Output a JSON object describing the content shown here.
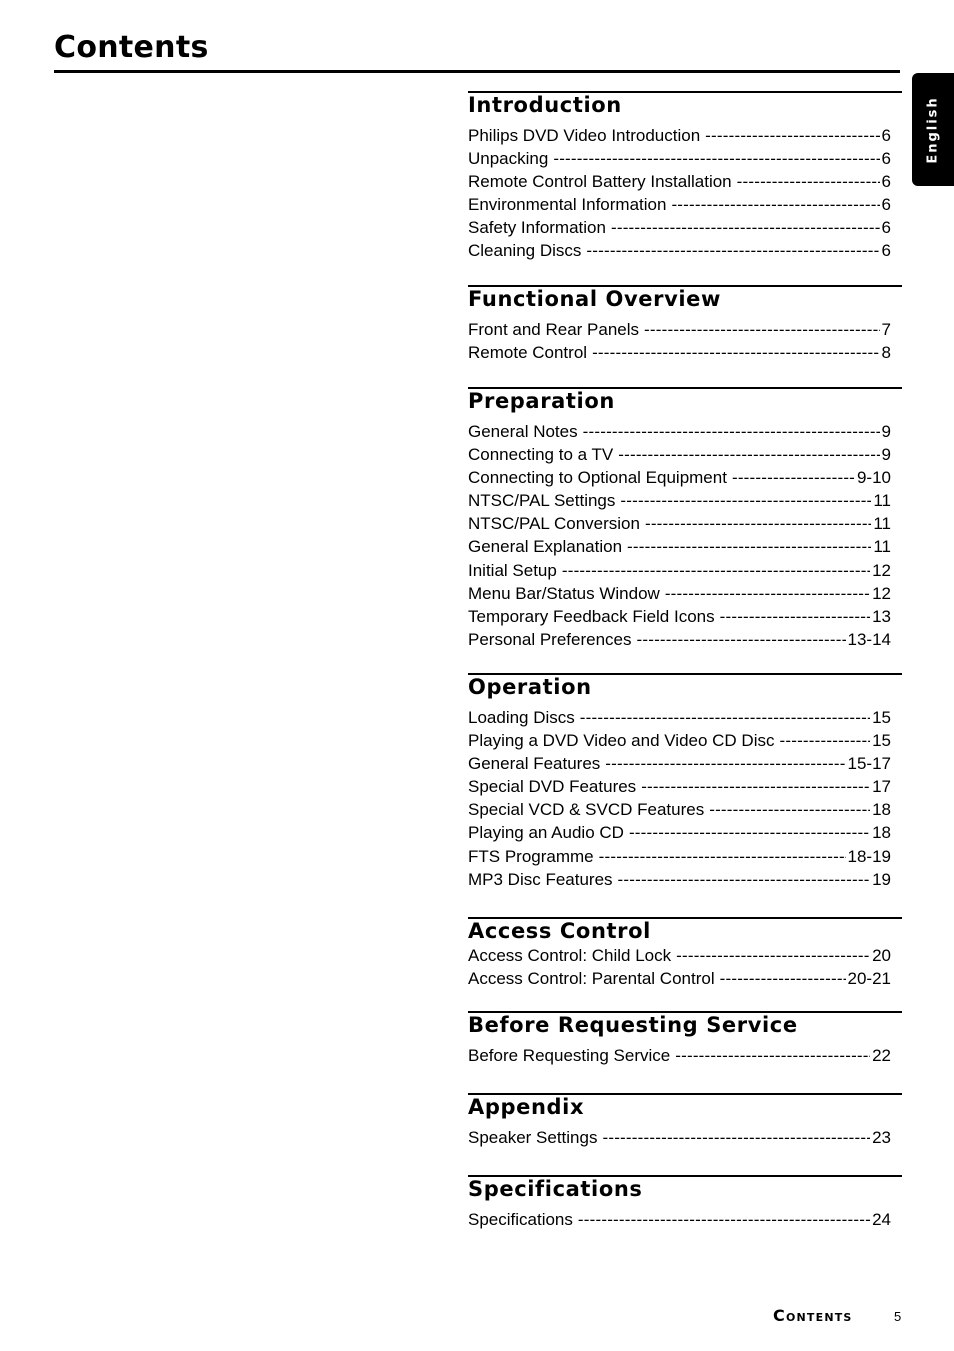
{
  "page": {
    "title": "Contents",
    "language_tab": "English",
    "footer_label": "Contents",
    "page_number": "5"
  },
  "sections": [
    {
      "title": "Introduction",
      "entries": [
        {
          "label": "Philips DVD Video Introduction",
          "page": "6"
        },
        {
          "label": "Unpacking",
          "page": "6"
        },
        {
          "label": "Remote Control Battery Installation",
          "page": "6"
        },
        {
          "label": "Environmental Information",
          "page": "6"
        },
        {
          "label": "Safety Information",
          "page": "6"
        },
        {
          "label": "Cleaning Discs",
          "page": "6"
        }
      ]
    },
    {
      "title": "Functional Overview",
      "entries": [
        {
          "label": "Front and Rear Panels",
          "page": "7"
        },
        {
          "label": "Remote Control",
          "page": "8"
        }
      ]
    },
    {
      "title": "Preparation",
      "entries": [
        {
          "label": "General Notes",
          "page": "9"
        },
        {
          "label": "Connecting to a TV",
          "page": "9"
        },
        {
          "label": "Connecting to Optional Equipment",
          "page": "9-10"
        },
        {
          "label": "NTSC/PAL Settings",
          "page": "11"
        },
        {
          "label": "NTSC/PAL Conversion",
          "page": "11"
        },
        {
          "label": "General Explanation",
          "page": "11"
        },
        {
          "label": "Initial Setup",
          "page": "12"
        },
        {
          "label": "Menu Bar/Status Window",
          "page": "12"
        },
        {
          "label": "Temporary Feedback Field Icons",
          "page": "13"
        },
        {
          "label": "Personal Preferences",
          "page": "13-14"
        }
      ]
    },
    {
      "title": "Operation",
      "entries": [
        {
          "label": "Loading Discs",
          "page": "15"
        },
        {
          "label": "Playing a DVD Video and Video CD Disc",
          "page": "15"
        },
        {
          "label": "General Features",
          "page": "15-17"
        },
        {
          "label": "Special DVD Features",
          "page": "17"
        },
        {
          "label": "Special VCD & SVCD Features",
          "page": "18"
        },
        {
          "label": "Playing an Audio CD",
          "page": "18"
        },
        {
          "label": "FTS Programme",
          "page": "18-19"
        },
        {
          "label": "MP3 Disc Features",
          "page": "19"
        }
      ]
    },
    {
      "title": "Access Control",
      "entries": [
        {
          "label": "Access Control: Child Lock",
          "page": "20"
        },
        {
          "label": "Access Control: Parental Control",
          "page": "20-21"
        }
      ]
    },
    {
      "title": "Before Requesting Service",
      "entries": [
        {
          "label": "Before Requesting Service",
          "page": "22"
        }
      ]
    },
    {
      "title": "Appendix",
      "entries": [
        {
          "label": "Speaker Settings",
          "page": "23"
        }
      ]
    },
    {
      "title": "Specifications",
      "entries": [
        {
          "label": "Specifications",
          "page": "24"
        }
      ]
    }
  ]
}
